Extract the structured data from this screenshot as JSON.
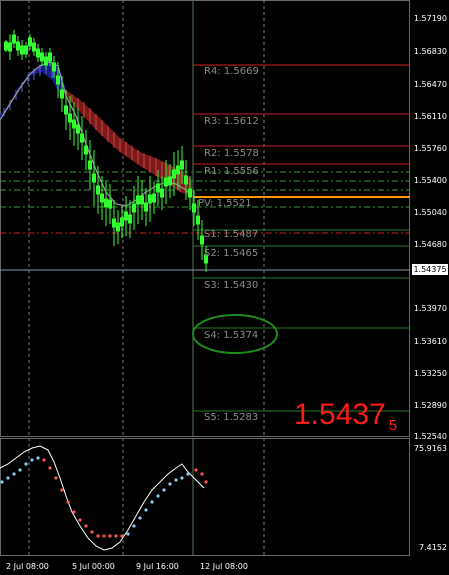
{
  "price_axis": {
    "labels": [
      "1.57190",
      "1.56830",
      "1.56470",
      "1.56110",
      "1.55760",
      "1.55400",
      "1.55040",
      "1.54680",
      "1.54375",
      "1.53970",
      "1.53610",
      "1.53250",
      "1.52890",
      "1.52540"
    ],
    "current": "1.54375"
  },
  "time_axis": {
    "labels": [
      "2 Jul 08:00",
      "5 Jul 00:00",
      "9 Jul 16:00",
      "12 Jul 08:00"
    ]
  },
  "pivots": {
    "r4": "R4: 1.5669",
    "r3": "R3: 1.5612",
    "r2": "R2: 1.5578",
    "r1": "R1: 1.5556",
    "pv": "PV: 1.5521",
    "s1": "S1: 1.5487",
    "s2": "S2: 1.5465",
    "s3": "S3: 1.5430",
    "s4": "S4: 1.5374",
    "s5": "S5: 1.5283"
  },
  "big_price": {
    "main": "1.5437",
    "digit": "5",
    "color": "#ff1a1a"
  },
  "oscillator": {
    "top": "75.9163",
    "bottom": "7.4152"
  },
  "colors": {
    "resistance": "#cc2222",
    "support": "#2a7a2a",
    "pivot": "#ff9900",
    "candle": "#33ff33"
  }
}
